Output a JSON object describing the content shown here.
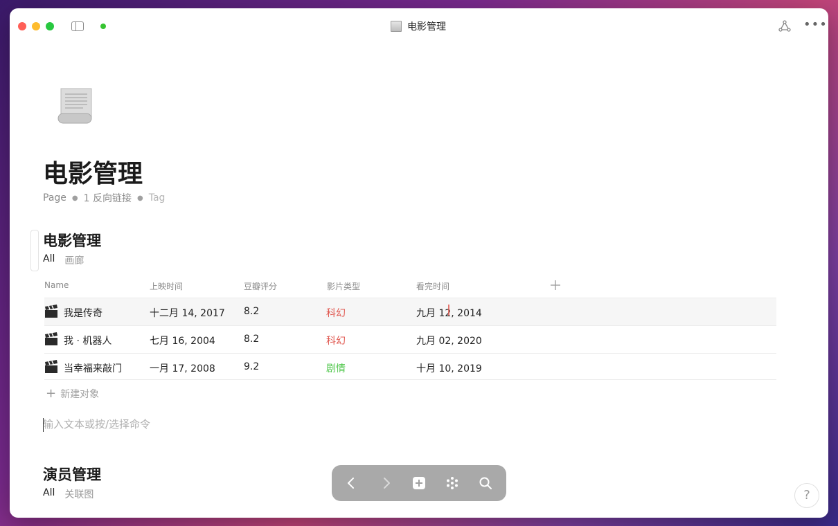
{
  "window": {
    "title": "电影管理",
    "icons": [
      "sidebar-toggle-icon",
      "sync-status-dot",
      "graph-icon",
      "more-icon"
    ]
  },
  "page": {
    "title": "电影管理",
    "meta": {
      "type": "Page",
      "backlinks": "1 反向链接",
      "tag": "Tag"
    }
  },
  "movies_db": {
    "title": "电影管理",
    "views": [
      "All",
      "画廊"
    ],
    "columns": [
      "Name",
      "上映时间",
      "豆瓣评分",
      "影片类型",
      "看完时间"
    ],
    "rows": [
      {
        "name": "我是传奇",
        "release": "十二月 14, 2017",
        "rating": "8.2",
        "genre": "科幻",
        "watched": "九月 12, 2014"
      },
      {
        "name": "我 · 机器人",
        "release": "七月 16, 2004",
        "rating": "8.2",
        "genre": "科幻",
        "watched": "九月 02, 2020"
      },
      {
        "name": "当幸福来敲门",
        "release": "一月 17, 2008",
        "rating": "9.2",
        "genre": "剧情",
        "watched": "十月 10, 2019"
      }
    ],
    "new_item": "新建对象"
  },
  "editor": {
    "placeholder": "输入文本或按/选择命令"
  },
  "actors_db": {
    "title": "演员管理",
    "views": [
      "All",
      "关联图"
    ]
  },
  "dock": {
    "buttons": [
      "back-icon",
      "forward-icon",
      "add-icon",
      "apps-icon",
      "search-icon"
    ]
  },
  "help": {
    "label": "?"
  },
  "colors": {
    "scifi": "#e0574f",
    "drama": "#4ec64a",
    "sync": "#36c431"
  }
}
